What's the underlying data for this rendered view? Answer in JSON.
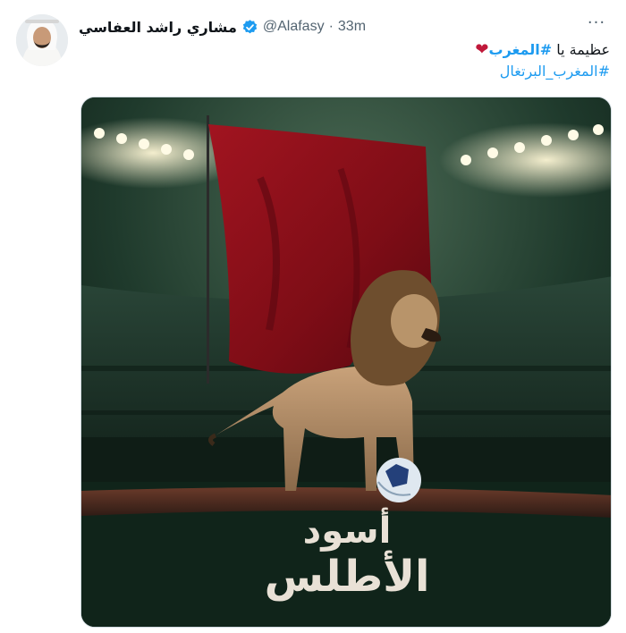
{
  "tweet": {
    "display_name": "مشاري راشد العفاسي",
    "handle": "@Alafasy",
    "separator": "·",
    "time": "33m",
    "more_label": "···",
    "text_line1_prefix": "عظيمة يا ",
    "text_line1_hashtag": "#المغرب",
    "text_line2_hashtag": "#المغرب_البرتغال",
    "heart": "❤"
  },
  "media": {
    "poster_text_line1": "أسود",
    "poster_text_line2": "الأطلس"
  },
  "icons": {
    "verified": "verified-badge-icon",
    "more": "more-options-icon",
    "heart": "heart-emoji-icon"
  },
  "colors": {
    "link": "#1d9bf0",
    "verified": "#1d9bf0",
    "secondary_text": "#536471",
    "heart": "#c0183a",
    "flag_red": "#b3121f"
  }
}
